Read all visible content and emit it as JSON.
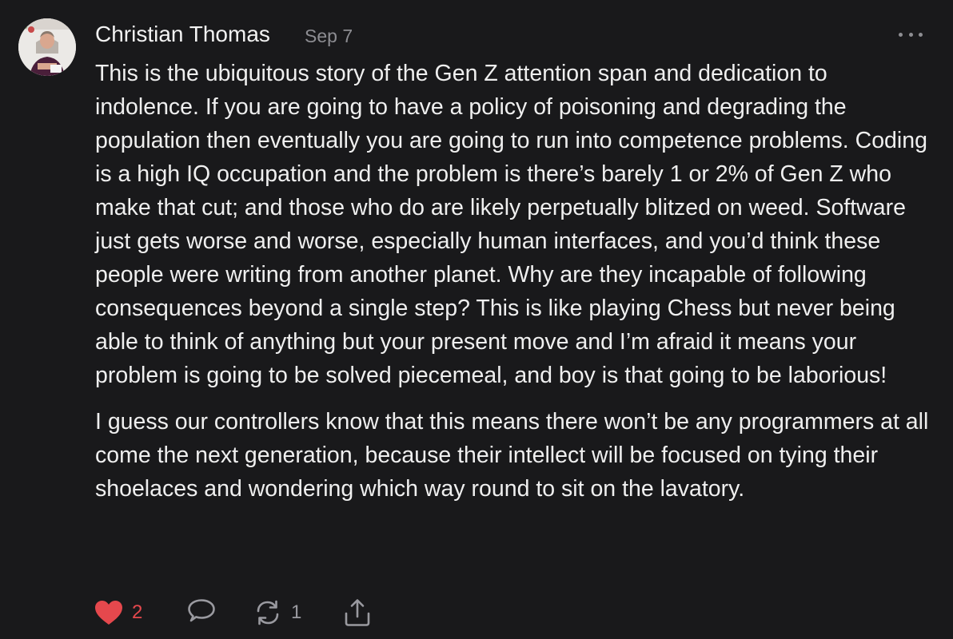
{
  "comment": {
    "author": "Christian Thomas",
    "date": "Sep 7",
    "paragraphs": [
      "This is the ubiquitous story of the Gen Z attention span and dedication to indolence. If you are going to have a policy of poisoning and degrading the population then eventually you are going to run into competence problems. Coding is a high IQ occupation and the problem is there’s barely 1 or 2% of Gen Z who make that cut; and those who do are likely perpetually blitzed on weed. Software just gets worse and worse, especially human interfaces, and you’d think these people were writing from another planet. Why are they incapable of following consequences beyond a single step? This is like playing Chess but never being able to think of anything but your present move and I’m afraid it means your problem is going to be solved piecemeal, and boy is that going to be laborious!",
      "I guess our controllers know that this means there won’t be any programmers at all come the next generation, because their intellect will be focused on tying their shoelaces and wondering which way round to sit on the lavatory."
    ],
    "actions": {
      "like_count": "2",
      "restack_count": "1"
    }
  },
  "colors": {
    "background": "#19191b",
    "text": "#efefef",
    "muted": "#8d8d92",
    "like_red": "#e5484d"
  },
  "icons": [
    "avatar-photo",
    "more-options-icon",
    "heart-icon",
    "reply-bubble-icon",
    "restack-icon",
    "share-icon"
  ]
}
